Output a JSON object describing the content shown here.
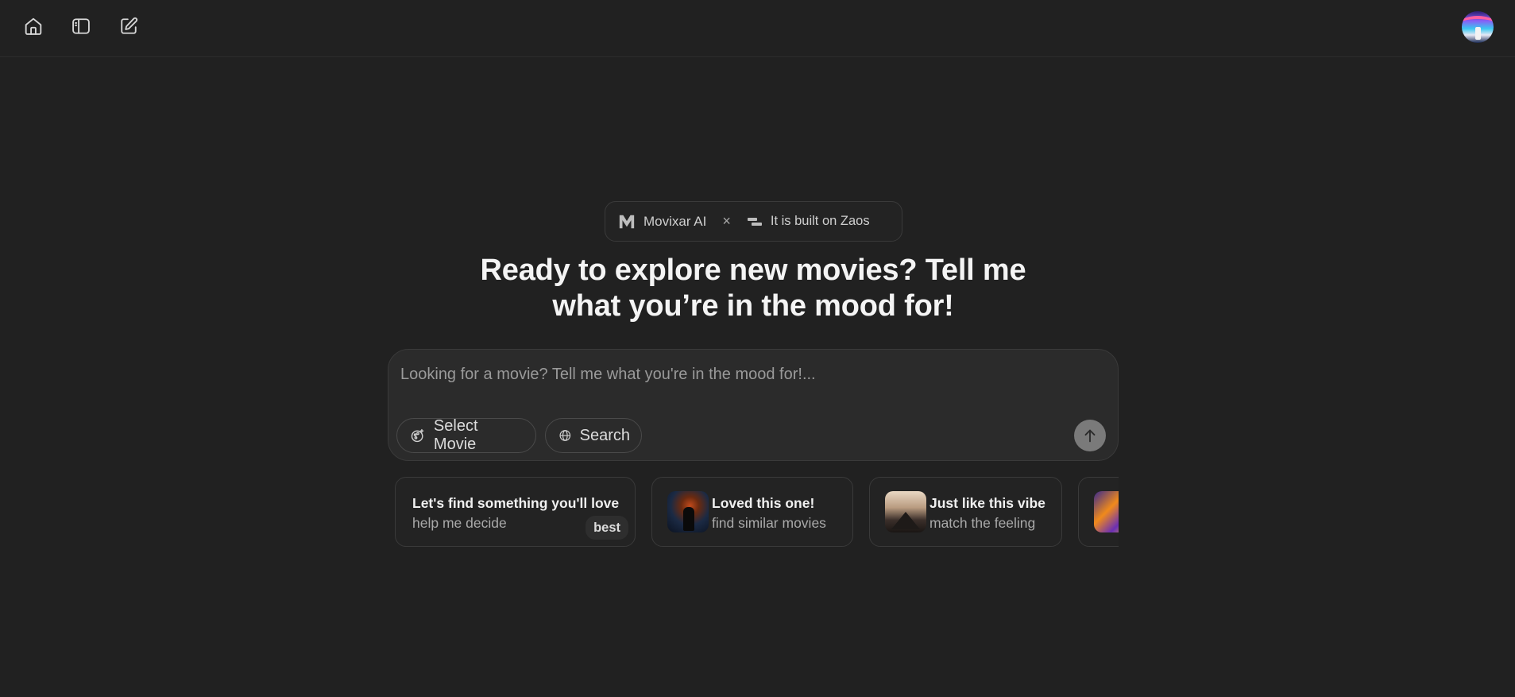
{
  "topbar": {
    "home_icon": "home-icon",
    "sidebar_icon": "sidebar-toggle-icon",
    "new_chat_icon": "edit-icon",
    "avatar_icon": "user-avatar"
  },
  "badge": {
    "brand_label": "Movixar AI",
    "separator": "×",
    "built_on_label": "It is built on Zaos"
  },
  "heading": {
    "line1": "Ready to explore new movies? Tell me",
    "line2": "what you’re in the mood for!"
  },
  "composer": {
    "placeholder": "Looking for a movie? Tell me what you're in the mood for!...",
    "value": "",
    "select_movie_label": "Select Movie",
    "search_label": "Search",
    "send_icon": "arrow-up-icon"
  },
  "suggestions": [
    {
      "title": "Let's find something you'll love",
      "subtitle": "help me decide",
      "badge": "best"
    },
    {
      "title": "Loved this one!",
      "subtitle": "find similar movies",
      "thumb": "dark-knight-poster"
    },
    {
      "title": "Just like this vibe",
      "subtitle": "match the feeling",
      "thumb": "titanic-poster"
    },
    {
      "title": "",
      "subtitle": "",
      "thumb": "animated-poster"
    }
  ],
  "colors": {
    "background": "#212121",
    "composer_bg": "#2b2b2b",
    "border": "#3a3a3a",
    "send_button": "#7a7a7a"
  }
}
